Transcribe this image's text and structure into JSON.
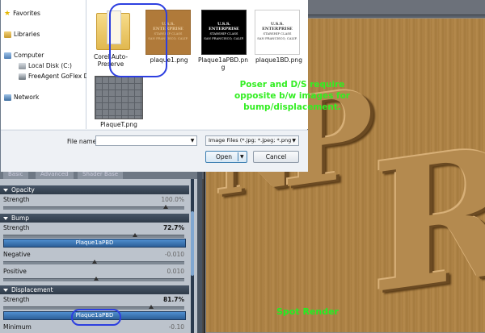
{
  "dialog": {
    "nav": [
      {
        "label": "Favorites",
        "icon": "star-icon"
      },
      {
        "label": "Libraries",
        "icon": "libraries-icon"
      },
      {
        "label": "Computer",
        "icon": "computer-icon"
      },
      {
        "label": "Local Disk (C:)",
        "icon": "disk-icon"
      },
      {
        "label": "FreeAgent GoFlex Dr",
        "icon": "drive-icon"
      },
      {
        "label": "Network",
        "icon": "network-icon"
      }
    ],
    "files": [
      {
        "label": "Corel Auto-Preserve",
        "kind": "folder"
      },
      {
        "label": "plaque1.png",
        "kind": "plaque-color"
      },
      {
        "label": "Plaque1aPBD.png",
        "kind": "plaque-black"
      },
      {
        "label": "plaque1BD.png",
        "kind": "plaque-white"
      },
      {
        "label": "PlaqueT.png",
        "kind": "grid"
      }
    ],
    "plaque": {
      "line1": "U.S.S. ENTERPRISE",
      "line2": "STARSHIP   CLASS",
      "line3": "SAN FRANCISCO, CALIF."
    },
    "annotation": "Poser and D/S require opposite b/w images for bump/displacement.",
    "filename_label": "File name:",
    "filename_value": "",
    "filetype": "Image Files (*.jpg; *.jpeg; *.png",
    "open_label": "Open",
    "cancel_label": "Cancel"
  },
  "panel": {
    "tabs": [
      "Basic",
      "Advanced",
      "Shader Base"
    ],
    "sections": {
      "opacity": {
        "title": "Opacity",
        "strength_label": "Strength",
        "strength_value": "100.0%"
      },
      "bump": {
        "title": "Bump",
        "strength_label": "Strength",
        "strength_value": "72.7%",
        "strength_fraction": 0.727,
        "map": "Plaque1aPBD",
        "negative_label": "Negative",
        "negative_value": "-0.010",
        "positive_label": "Positive",
        "positive_value": "0.010"
      },
      "displacement": {
        "title": "Displacement",
        "strength_label": "Strength",
        "strength_value": "81.7%",
        "strength_fraction": 0.817,
        "map": "Plaque1aPBD",
        "minimum_label": "Minimum",
        "minimum_value": "-0.10"
      }
    }
  },
  "viewport": {
    "letters": [
      "N",
      "P",
      "R"
    ],
    "caption": "Spot Render"
  }
}
